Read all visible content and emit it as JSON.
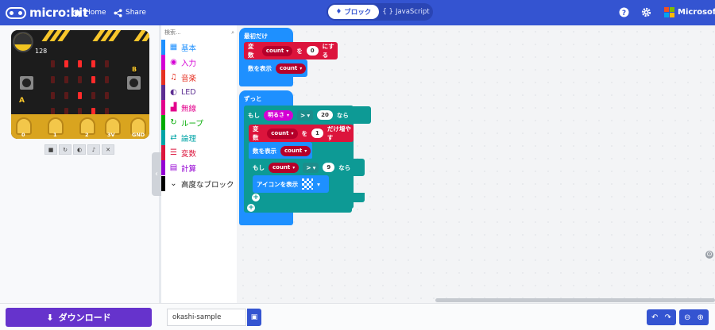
{
  "header": {
    "logo_text": "micro:bit",
    "home_label": "Home",
    "share_label": "Share",
    "blocks_label": "ブロック",
    "javascript_label": "JavaScript",
    "brand_label": "Microsoft"
  },
  "simulator": {
    "gauge_value": "128",
    "label_a": "A",
    "label_b": "B",
    "pins": [
      "0",
      "1",
      "2",
      "3V",
      "GND"
    ],
    "controls": [
      "stop",
      "restart",
      "slow-mo",
      "mute",
      "close"
    ]
  },
  "toolbox": {
    "search_placeholder": "検索...",
    "categories": [
      {
        "label": "基本",
        "color": "#1e90ff"
      },
      {
        "label": "入力",
        "color": "#d400d4"
      },
      {
        "label": "音楽",
        "color": "#e63022"
      },
      {
        "label": "LED",
        "color": "#5c2d91"
      },
      {
        "label": "無線",
        "color": "#e3008c"
      },
      {
        "label": "ループ",
        "color": "#00aa00"
      },
      {
        "label": "論理",
        "color": "#00a4a6"
      },
      {
        "label": "変数",
        "color": "#dc143c"
      },
      {
        "label": "計算",
        "color": "#9400d3"
      },
      {
        "label": "高度なブロック",
        "color": "#000000"
      }
    ]
  },
  "workspace": {
    "on_start": {
      "title": "最初だけ",
      "set_var": {
        "label": "変数",
        "var": "count",
        "to": "を",
        "value": "0",
        "suffix": "にする"
      },
      "show_number": {
        "label": "数を表示",
        "var": "count"
      }
    },
    "forever": {
      "title": "ずっと",
      "if1": {
        "label": "もし",
        "sensor": "明るさ",
        "op": ">",
        "value": "20",
        "then": "なら"
      },
      "change_var": {
        "label": "変数",
        "var": "count",
        "by": "を",
        "value": "1",
        "suffix": "だけ増やす"
      },
      "show_number": {
        "label": "数を表示",
        "var": "count"
      },
      "if2": {
        "label": "もし",
        "var": "count",
        "op": ">",
        "value": "9",
        "then": "なら"
      },
      "show_icon": {
        "label": "アイコンを表示"
      }
    }
  },
  "footer": {
    "download_label": "ダウンロード",
    "project_name": "okashi-sample"
  },
  "colors": {
    "header": "#3454d1",
    "download": "#6633cc",
    "events_block": "#1e90ff",
    "logic_block": "#0d9a95",
    "variable_block": "#dc143c",
    "input_block": "#d400d4"
  }
}
